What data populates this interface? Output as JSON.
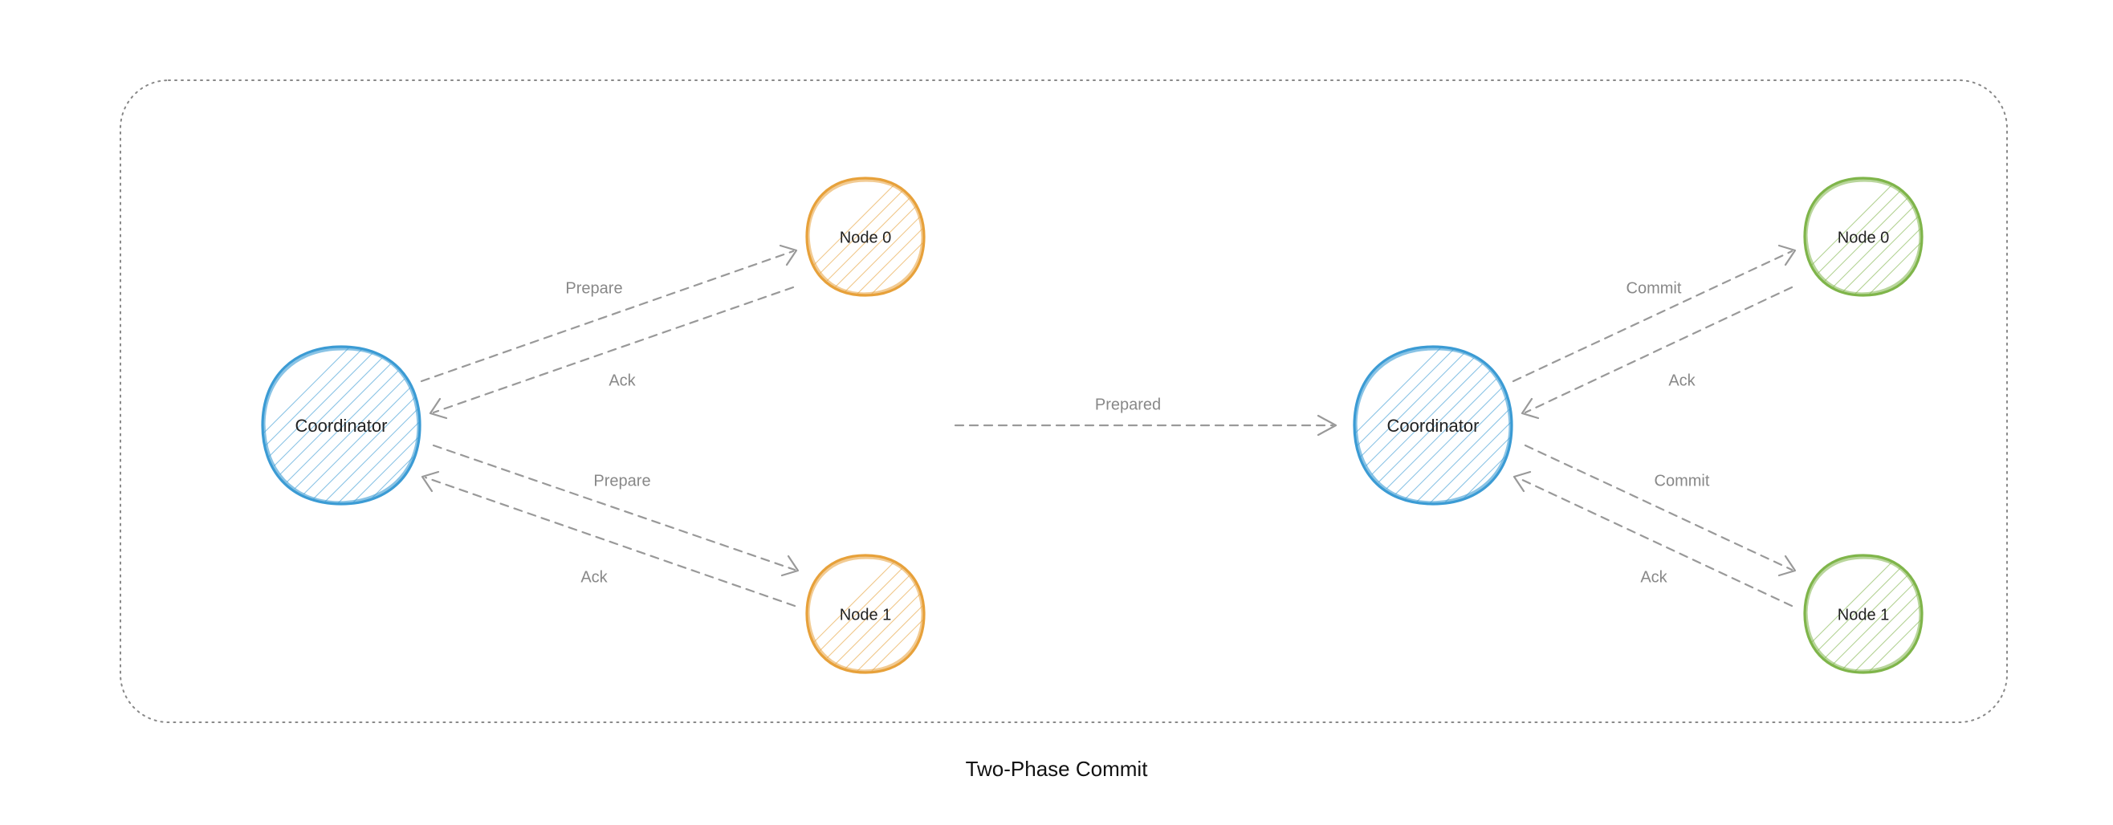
{
  "diagram": {
    "title": "Two-Phase Commit",
    "transition_label": "Prepared",
    "phase1": {
      "coordinator": "Coordinator",
      "nodes": [
        "Node 0",
        "Node 1"
      ],
      "send_label": "Prepare",
      "reply_label": "Ack",
      "node_color": "#e7a13a",
      "coord_color": "#3b9bd4"
    },
    "phase2": {
      "coordinator": "Coordinator",
      "nodes": [
        "Node 0",
        "Node 1"
      ],
      "send_label": "Commit",
      "reply_label": "Ack",
      "node_color": "#7fb54a",
      "coord_color": "#3b9bd4"
    }
  }
}
